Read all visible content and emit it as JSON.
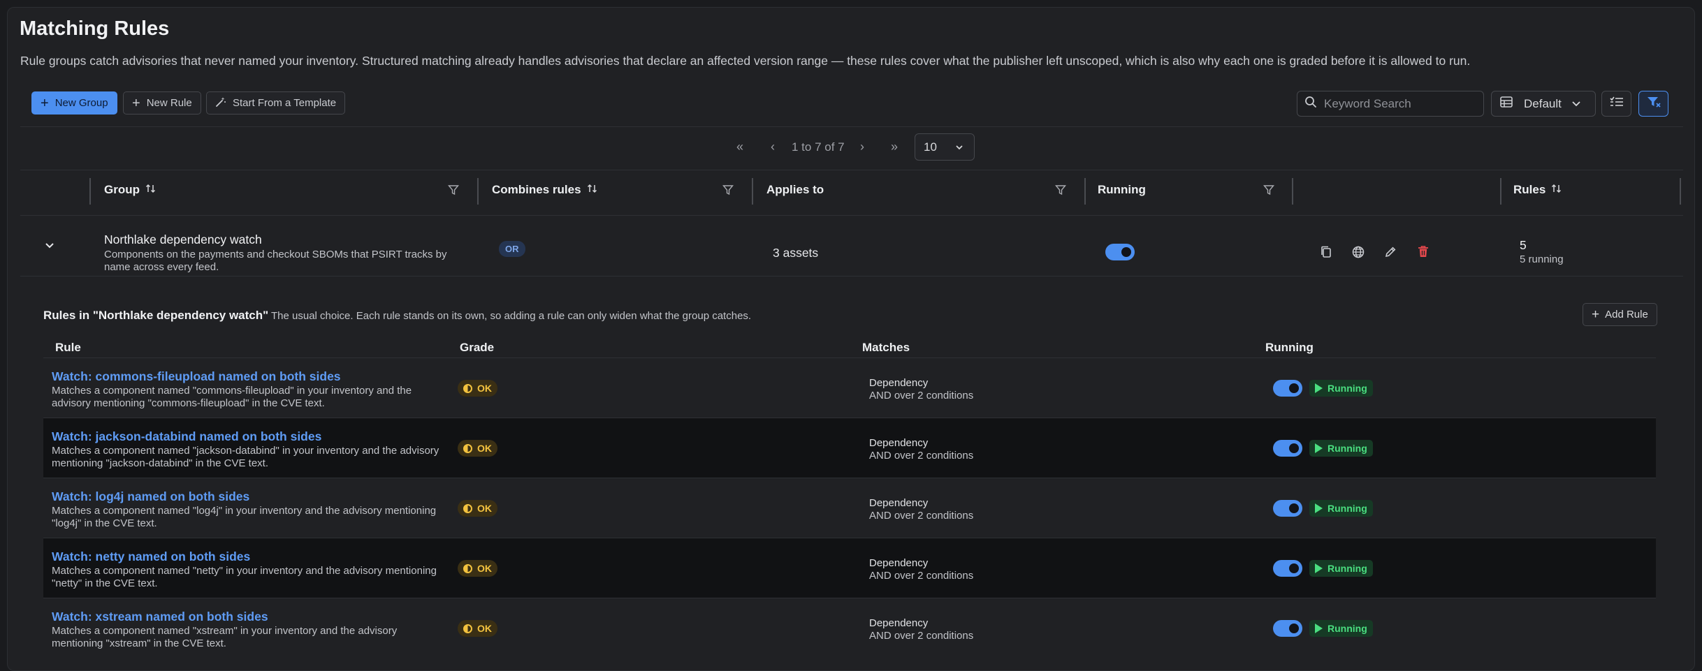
{
  "page": {
    "title": "Matching Rules",
    "description": "Rule groups catch advisories that never named your inventory. Structured matching already handles advisories that declare an affected version range — these rules cover what the publisher left unscoped, which is also why each one is graded before it is allowed to run."
  },
  "toolbar": {
    "new_group": "New Group",
    "new_rule": "New Rule",
    "template": "Start From a Template",
    "search_placeholder": "Keyword Search",
    "view_label": "Default"
  },
  "pagination": {
    "first": "«",
    "prev": "‹",
    "range": "1 to 7 of 7",
    "next": "›",
    "last": "»",
    "page_size": "10"
  },
  "table": {
    "columns": {
      "group": "Group",
      "combines": "Combines rules",
      "applies": "Applies to",
      "running": "Running",
      "rules": "Rules"
    }
  },
  "group": {
    "name": "Northlake dependency watch",
    "description": "Components on the payments and checkout SBOMs that PSIRT tracks by name across every feed.",
    "combine": "OR",
    "applies": "3 assets",
    "running": true,
    "rules_count": "5",
    "rules_running": "5 running"
  },
  "subtable": {
    "title": "Rules in \"Northlake dependency watch\"",
    "note": "The usual choice. Each rule stands on its own, so adding a rule can only widen what the group catches.",
    "add_rule": "Add Rule",
    "columns": {
      "rule": "Rule",
      "grade": "Grade",
      "matches": "Matches",
      "running": "Running"
    },
    "rows": [
      {
        "name": "Watch: commons-fileupload named on both sides",
        "desc": "Matches a component named \"commons-fileupload\" in your inventory and the advisory mentioning \"commons-fileupload\" in the CVE text.",
        "grade": "OK",
        "match_type": "Dependency",
        "match_detail": "AND over 2 conditions",
        "running_label": "Running"
      },
      {
        "name": "Watch: jackson-databind named on both sides",
        "desc": "Matches a component named \"jackson-databind\" in your inventory and the advisory mentioning \"jackson-databind\" in the CVE text.",
        "grade": "OK",
        "match_type": "Dependency",
        "match_detail": "AND over 2 conditions",
        "running_label": "Running"
      },
      {
        "name": "Watch: log4j named on both sides",
        "desc": "Matches a component named \"log4j\" in your inventory and the advisory mentioning \"log4j\" in the CVE text.",
        "grade": "OK",
        "match_type": "Dependency",
        "match_detail": "AND over 2 conditions",
        "running_label": "Running"
      },
      {
        "name": "Watch: netty named on both sides",
        "desc": "Matches a component named \"netty\" in your inventory and the advisory mentioning \"netty\" in the CVE text.",
        "grade": "OK",
        "match_type": "Dependency",
        "match_detail": "AND over 2 conditions",
        "running_label": "Running"
      },
      {
        "name": "Watch: xstream named on both sides",
        "desc": "Matches a component named \"xstream\" in your inventory and the advisory mentioning \"xstream\" in the CVE text.",
        "grade": "OK",
        "match_type": "Dependency",
        "match_detail": "AND over 2 conditions",
        "running_label": "Running"
      }
    ]
  },
  "colors": {
    "accent": "#4c8ff0",
    "running_green": "#4ade80",
    "grade_amber": "#f3c23f",
    "delete_red": "#e5484d"
  }
}
